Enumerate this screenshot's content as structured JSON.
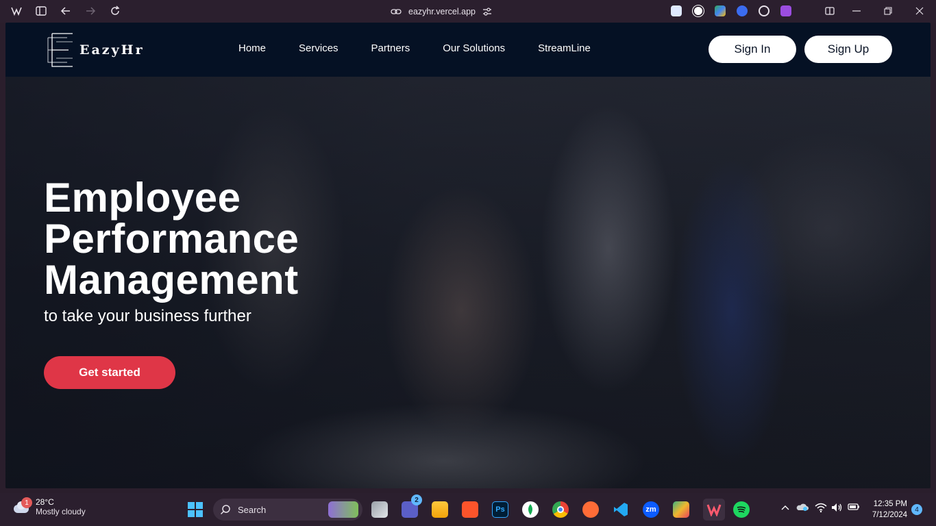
{
  "browser": {
    "url": "eazyhr.vercel.app"
  },
  "navbar": {
    "logo_text": "EazyHr",
    "links": [
      "Home",
      "Services",
      "Partners",
      "Our Solutions",
      "StreamLine"
    ],
    "sign_in": "Sign In",
    "sign_up": "Sign Up"
  },
  "hero": {
    "title_lines": [
      "Employee",
      "Performance",
      "Management"
    ],
    "subtitle": "to take your business further",
    "cta": "Get started"
  },
  "taskbar": {
    "weather_temp": "28°C",
    "weather_condition": "Mostly cloudy",
    "weather_badge": "1",
    "search_label": "Search",
    "teams_badge": "2",
    "time": "12:35 PM",
    "date": "7/12/2024",
    "notification_count": "4",
    "apps": [
      "task-view",
      "teams",
      "file-explorer",
      "brave",
      "photoshop",
      "mongodb-compass",
      "chrome",
      "postman",
      "vscode",
      "zoom",
      "gitkraken",
      "cursor-browser",
      "spotify"
    ]
  },
  "colors": {
    "navbar_bg": "#051124",
    "cta_bg": "#df3647",
    "taskbar_bg": "#2b1f2e"
  }
}
